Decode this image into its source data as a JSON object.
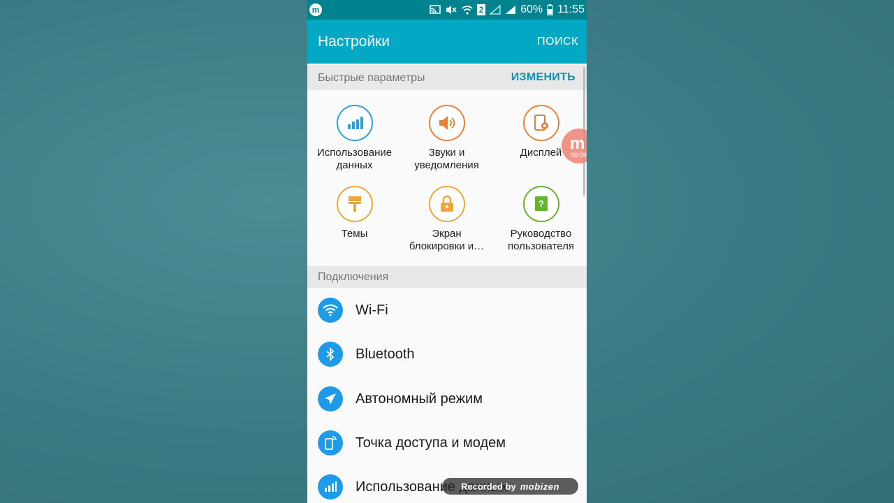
{
  "status_bar": {
    "battery": "60%",
    "time": "11:55",
    "sim": "2",
    "app_badge": "m"
  },
  "appbar": {
    "title": "Настройки",
    "search_label": "ПОИСК"
  },
  "quick": {
    "header": "Быстрые параметры",
    "edit_label": "ИЗМЕНИТЬ",
    "items": [
      {
        "label_1": "Использование",
        "label_2": "данных",
        "icon": "bar-chart-icon",
        "color": "#2d9fd8"
      },
      {
        "label_1": "Звуки и",
        "label_2": "уведомления",
        "icon": "speaker-icon",
        "color": "#e9813a"
      },
      {
        "label_1": "Дисплей",
        "label_2": "",
        "icon": "display-settings-icon",
        "color": "#e9813a"
      },
      {
        "label_1": "Темы",
        "label_2": "",
        "icon": "paintbrush-icon",
        "color": "#eba73c"
      },
      {
        "label_1": "Экран",
        "label_2": "блокировки и…",
        "icon": "lock-icon",
        "color": "#eba73c"
      },
      {
        "label_1": "Руководство",
        "label_2": "пользователя",
        "icon": "user-manual-icon",
        "color": "#65b32e"
      }
    ]
  },
  "connections": {
    "header": "Подключения",
    "items": [
      {
        "label": "Wi-Fi",
        "icon": "wifi-icon"
      },
      {
        "label": "Bluetooth",
        "icon": "bluetooth-icon"
      },
      {
        "label": "Автономный режим",
        "icon": "airplane-icon"
      },
      {
        "label": "Точка доступа и модем",
        "icon": "hotspot-icon"
      },
      {
        "label": "Использование данных",
        "icon": "bar-chart-icon"
      }
    ]
  },
  "recorder": {
    "bubble_letter": "m",
    "bubble_time": "00:09",
    "watermark_prefix": "Recorded by",
    "watermark_brand": "mobizen"
  }
}
